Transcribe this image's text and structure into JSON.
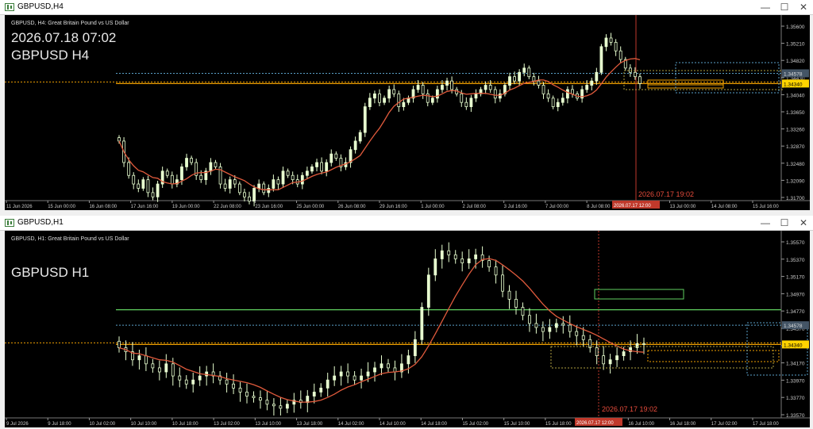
{
  "window1": {
    "title": "GBPUSD,H4",
    "subtitle": "GBPUSD, H4: Great Britain Pound vs US Dollar",
    "overlay_line1": "2026.07.18 07:02",
    "overlay_line2": "GBPUSD H4",
    "crosshair_label": "2026.07.17 19:02",
    "crosshair_date_box": "2026.07.17 12:00",
    "price_labels": [
      "1.35600",
      "1.35210",
      "1.34820",
      "1.34430",
      "1.34040",
      "1.33650",
      "1.33260",
      "1.32870",
      "1.32480",
      "1.32090",
      "1.31700"
    ],
    "current_price_box": "1.34340",
    "dotted_price_box": "1.34578",
    "time_labels": [
      "11 Jun 2026",
      "15 Jun 00:00",
      "16 Jun 08:00",
      "17 Jun 16:00",
      "19 Jun 00:00",
      "22 Jun 08:00",
      "23 Jun 16:00",
      "25 Jun 00:00",
      "26 Jun 08:00",
      "29 Jun 16:00",
      "1 Jul 00:00",
      "2 Jul 08:00",
      "3 Jul 16:00",
      "7 Jul 00:00",
      "8 Jul 08:00",
      "9 Jul 16:00",
      "13 Jul 00:00",
      "14 Jul 08:00",
      "15 Jul 16:00"
    ]
  },
  "window2": {
    "title": "GBPUSD,H1",
    "subtitle": "GBPUSD, H1: Great Britain Pound vs US Dollar",
    "overlay_line1": "GBPUSD H1",
    "crosshair_label": "2026.07.17 19:02",
    "crosshair_date_box": "2026.07.17 12:00",
    "price_labels": [
      "1.35570",
      "1.35370",
      "1.35170",
      "1.34970",
      "1.34770",
      "1.34570",
      "1.34370",
      "1.34170",
      "1.33970",
      "1.33770",
      "1.33570"
    ],
    "current_price_box": "1.34340",
    "dotted_price_box": "1.34578",
    "time_labels": [
      "9 Jul 2026",
      "9 Jul 18:00",
      "10 Jul 02:00",
      "10 Jul 10:00",
      "10 Jul 18:00",
      "13 Jul 02:00",
      "13 Jul 10:00",
      "13 Jul 18:00",
      "14 Jul 02:00",
      "14 Jul 10:00",
      "14 Jul 18:00",
      "15 Jul 02:00",
      "15 Jul 10:00",
      "15 Jul 18:00",
      "16 Jul 02:00",
      "16 Jul 10:00",
      "16 Jul 18:00",
      "17 Jul 02:00",
      "17 Jul 18:00"
    ]
  },
  "controls": {
    "minimize": "—",
    "maximize": "☐",
    "close": "✕"
  },
  "colors": {
    "background": "#000000",
    "bull": "#e8ffd0",
    "bear": "#e8ffd0",
    "ma": "#e05a3c",
    "orange_level": "#f0a000",
    "green_level": "#60d060",
    "dotted_level": "#5aa0c8",
    "crosshair": "#c0392b"
  },
  "chart_data": [
    {
      "type": "candlestick",
      "title": "GBPUSD, H4: Great Britain Pound vs US Dollar",
      "ylim": [
        1.3165,
        1.3575
      ],
      "x_ticks": [
        "11 Jun 2026",
        "15 Jun 00:00",
        "16 Jun 08:00",
        "17 Jun 16:00",
        "19 Jun 00:00",
        "22 Jun 08:00",
        "23 Jun 16:00",
        "25 Jun 00:00",
        "26 Jun 08:00",
        "29 Jun 16:00",
        "1 Jul 00:00",
        "2 Jul 08:00",
        "3 Jul 16:00",
        "7 Jul 00:00",
        "8 Jul 08:00",
        "9 Jul 16:00",
        "13 Jul 00:00",
        "14 Jul 08:00",
        "15 Jul 16:00"
      ],
      "closes": [
        1.33,
        1.325,
        1.322,
        1.32,
        1.319,
        1.321,
        1.318,
        1.317,
        1.32,
        1.323,
        1.322,
        1.32,
        1.321,
        1.324,
        1.326,
        1.325,
        1.322,
        1.321,
        1.323,
        1.325,
        1.324,
        1.32,
        1.319,
        1.321,
        1.32,
        1.318,
        1.317,
        1.316,
        1.319,
        1.32,
        1.318,
        1.319,
        1.321,
        1.32,
        1.323,
        1.322,
        1.321,
        1.32,
        1.322,
        1.323,
        1.324,
        1.325,
        1.323,
        1.325,
        1.327,
        1.326,
        1.324,
        1.325,
        1.328,
        1.33,
        1.332,
        1.338,
        1.34,
        1.341,
        1.339,
        1.34,
        1.342,
        1.341,
        1.338,
        1.339,
        1.34,
        1.342,
        1.343,
        1.341,
        1.339,
        1.34,
        1.342,
        1.343,
        1.344,
        1.342,
        1.341,
        1.339,
        1.338,
        1.34,
        1.341,
        1.342,
        1.343,
        1.342,
        1.34,
        1.341,
        1.343,
        1.345,
        1.344,
        1.346,
        1.347,
        1.345,
        1.344,
        1.343,
        1.341,
        1.34,
        1.338,
        1.339,
        1.34,
        1.342,
        1.341,
        1.34,
        1.342,
        1.343,
        1.344,
        1.346,
        1.352,
        1.354,
        1.353,
        1.351,
        1.349,
        1.347,
        1.346,
        1.345,
        1.3434
      ],
      "ma_period_note": "",
      "levels": {
        "orange": 1.3434,
        "dotted_blue": 1.34578
      }
    },
    {
      "type": "candlestick",
      "title": "GBPUSD, H1: Great Britain Pound vs US Dollar",
      "ylim": [
        1.3345,
        1.3565
      ],
      "x_ticks": [
        "9 Jul 2026",
        "9 Jul 18:00",
        "10 Jul 02:00",
        "10 Jul 10:00",
        "10 Jul 18:00",
        "13 Jul 02:00",
        "13 Jul 10:00",
        "13 Jul 18:00",
        "14 Jul 02:00",
        "14 Jul 10:00",
        "14 Jul 18:00",
        "15 Jul 02:00",
        "15 Jul 10:00",
        "15 Jul 18:00",
        "16 Jul 02:00",
        "16 Jul 10:00",
        "16 Jul 18:00",
        "17 Jul 02:00",
        "17 Jul 18:00"
      ],
      "closes": [
        1.343,
        1.3425,
        1.3415,
        1.342,
        1.341,
        1.3405,
        1.34,
        1.341,
        1.3395,
        1.339,
        1.3385,
        1.339,
        1.3395,
        1.34,
        1.3395,
        1.339,
        1.3385,
        1.338,
        1.3375,
        1.337,
        1.3368,
        1.3365,
        1.336,
        1.3358,
        1.3355,
        1.336,
        1.3365,
        1.3362,
        1.337,
        1.3375,
        1.338,
        1.339,
        1.3395,
        1.34,
        1.3395,
        1.339,
        1.3395,
        1.34,
        1.3405,
        1.341,
        1.3405,
        1.34,
        1.341,
        1.342,
        1.344,
        1.348,
        1.352,
        1.354,
        1.355,
        1.3545,
        1.354,
        1.3535,
        1.354,
        1.3545,
        1.3538,
        1.353,
        1.352,
        1.35,
        1.349,
        1.348,
        1.347,
        1.346,
        1.3455,
        1.345,
        1.3455,
        1.346,
        1.3458,
        1.345,
        1.3445,
        1.344,
        1.343,
        1.342,
        1.341,
        1.3415,
        1.342,
        1.3425,
        1.343,
        1.3435,
        1.3434
      ],
      "levels": {
        "green": 1.3477,
        "orange": 1.3434,
        "dotted_blue": 1.34578
      }
    }
  ]
}
